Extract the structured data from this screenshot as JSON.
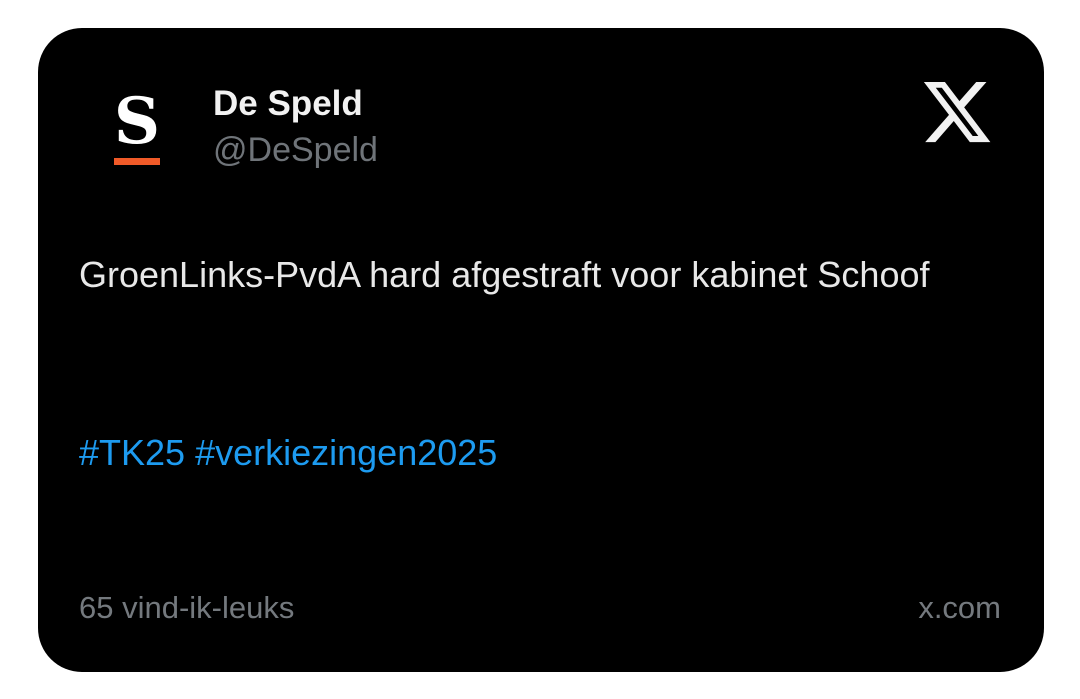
{
  "author": {
    "display_name": "De Speld",
    "handle": "@DeSpeld",
    "avatar_letter": "S",
    "avatar_accent_color": "#f05a28"
  },
  "platform": {
    "logo_icon": "x-logo-icon",
    "source_label": "x.com"
  },
  "tweet": {
    "text": "GroenLinks-PvdA hard afgestraft voor kabinet Schoof",
    "hashtags": [
      "#TK25",
      "#verkiezingen2025"
    ],
    "hashtag_color": "#1d9bf0"
  },
  "footer": {
    "likes_label": "65 vind-ik-leuks"
  }
}
